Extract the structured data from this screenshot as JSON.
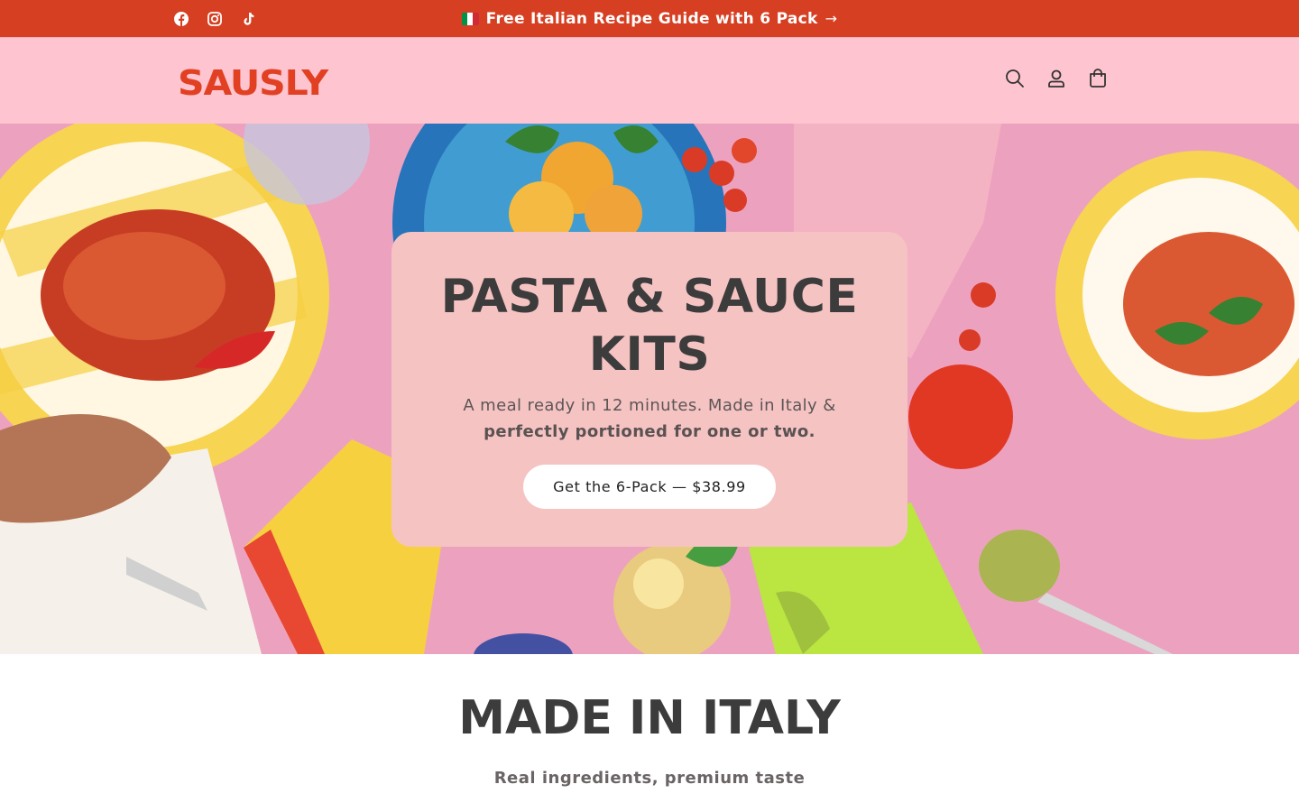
{
  "announcement": {
    "text": "Free Italian Recipe Guide with 6 Pack",
    "arrow": "→",
    "flag_colors": [
      "#009246",
      "#ffffff",
      "#ce2b37"
    ],
    "background": "#d63f22"
  },
  "social": {
    "icons": [
      "facebook-icon",
      "instagram-icon",
      "tiktok-icon"
    ]
  },
  "header": {
    "logo_text": "SAUSLY",
    "logo_color": "#e14023",
    "background": "#fec4cf",
    "icons": [
      "search-icon",
      "account-icon",
      "cart-icon"
    ]
  },
  "hero": {
    "title_line1": "PASTA & SAUCE",
    "title_line2": "KITS",
    "subtitle_plain": "A meal ready in 12 minutes. Made in Italy &",
    "subtitle_bold": "perfectly portioned for one or two.",
    "cta_label": "Get the 6-Pack — $38.99",
    "card_color": "#f6c3c3"
  },
  "section": {
    "title": "MADE IN ITALY",
    "subtitle": "Real ingredients, premium taste"
  }
}
